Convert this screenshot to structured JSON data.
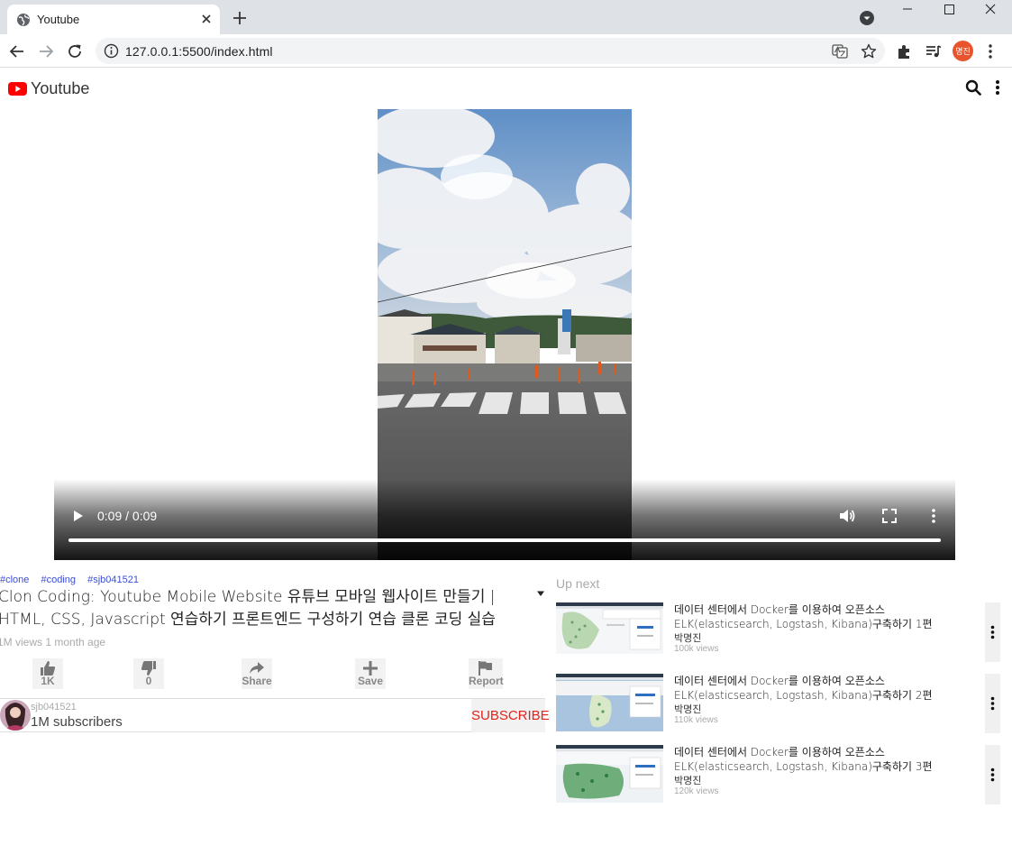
{
  "browser": {
    "tab_title": "Youtube",
    "url": "127.0.0.1:5500/index.html",
    "profile_initials": "명진",
    "profile_color": "#e8542c"
  },
  "header": {
    "logo_text": "Youtube",
    "logo_color": "#ff0000"
  },
  "player": {
    "time": "0:09 / 0:09",
    "progress": 1.0
  },
  "video_info": {
    "tags": [
      "#clone",
      "#coding",
      "#sjb041521"
    ],
    "title": "Clon Coding: Youtube Mobile Website 유튜브 모바일 웹사이트 만들기 | HTML, CSS, Javascript 연습하기 프론트엔드 구성하기 연습 클론 코딩 실습",
    "meta": "1M views 1 month age",
    "actions": [
      {
        "name": "like",
        "label": "1K",
        "icon": "thumbs-up-icon"
      },
      {
        "name": "dislike",
        "label": "0",
        "icon": "thumbs-down-icon"
      },
      {
        "name": "share",
        "label": "Share",
        "icon": "share-icon"
      },
      {
        "name": "save",
        "label": "Save",
        "icon": "plus-icon"
      },
      {
        "name": "report",
        "label": "Report",
        "icon": "flag-icon"
      }
    ]
  },
  "channel": {
    "name": "sjb041521",
    "subscribers": "1M subscribers",
    "subscribe_label": "SUBSCRIBE",
    "subscribe_color": "#e62117"
  },
  "up_next": {
    "label": "Up next",
    "items": [
      {
        "title": "데이터 센터에서 Docker를 이용하여 오픈소스 ELK(elasticsearch, Logstash, Kibana)구축하기 1편",
        "author": "박명진",
        "views": "100k views"
      },
      {
        "title": "데이터 센터에서 Docker를 이용하여 오픈소스 ELK(elasticsearch, Logstash, Kibana)구축하기 2편",
        "author": "박명진",
        "views": "110k views"
      },
      {
        "title": "데이터 센터에서 Docker를 이용하여 오픈소스 ELK(elasticsearch, Logstash, Kibana)구축하기 3편",
        "author": "박명진",
        "views": "120k views"
      }
    ]
  }
}
